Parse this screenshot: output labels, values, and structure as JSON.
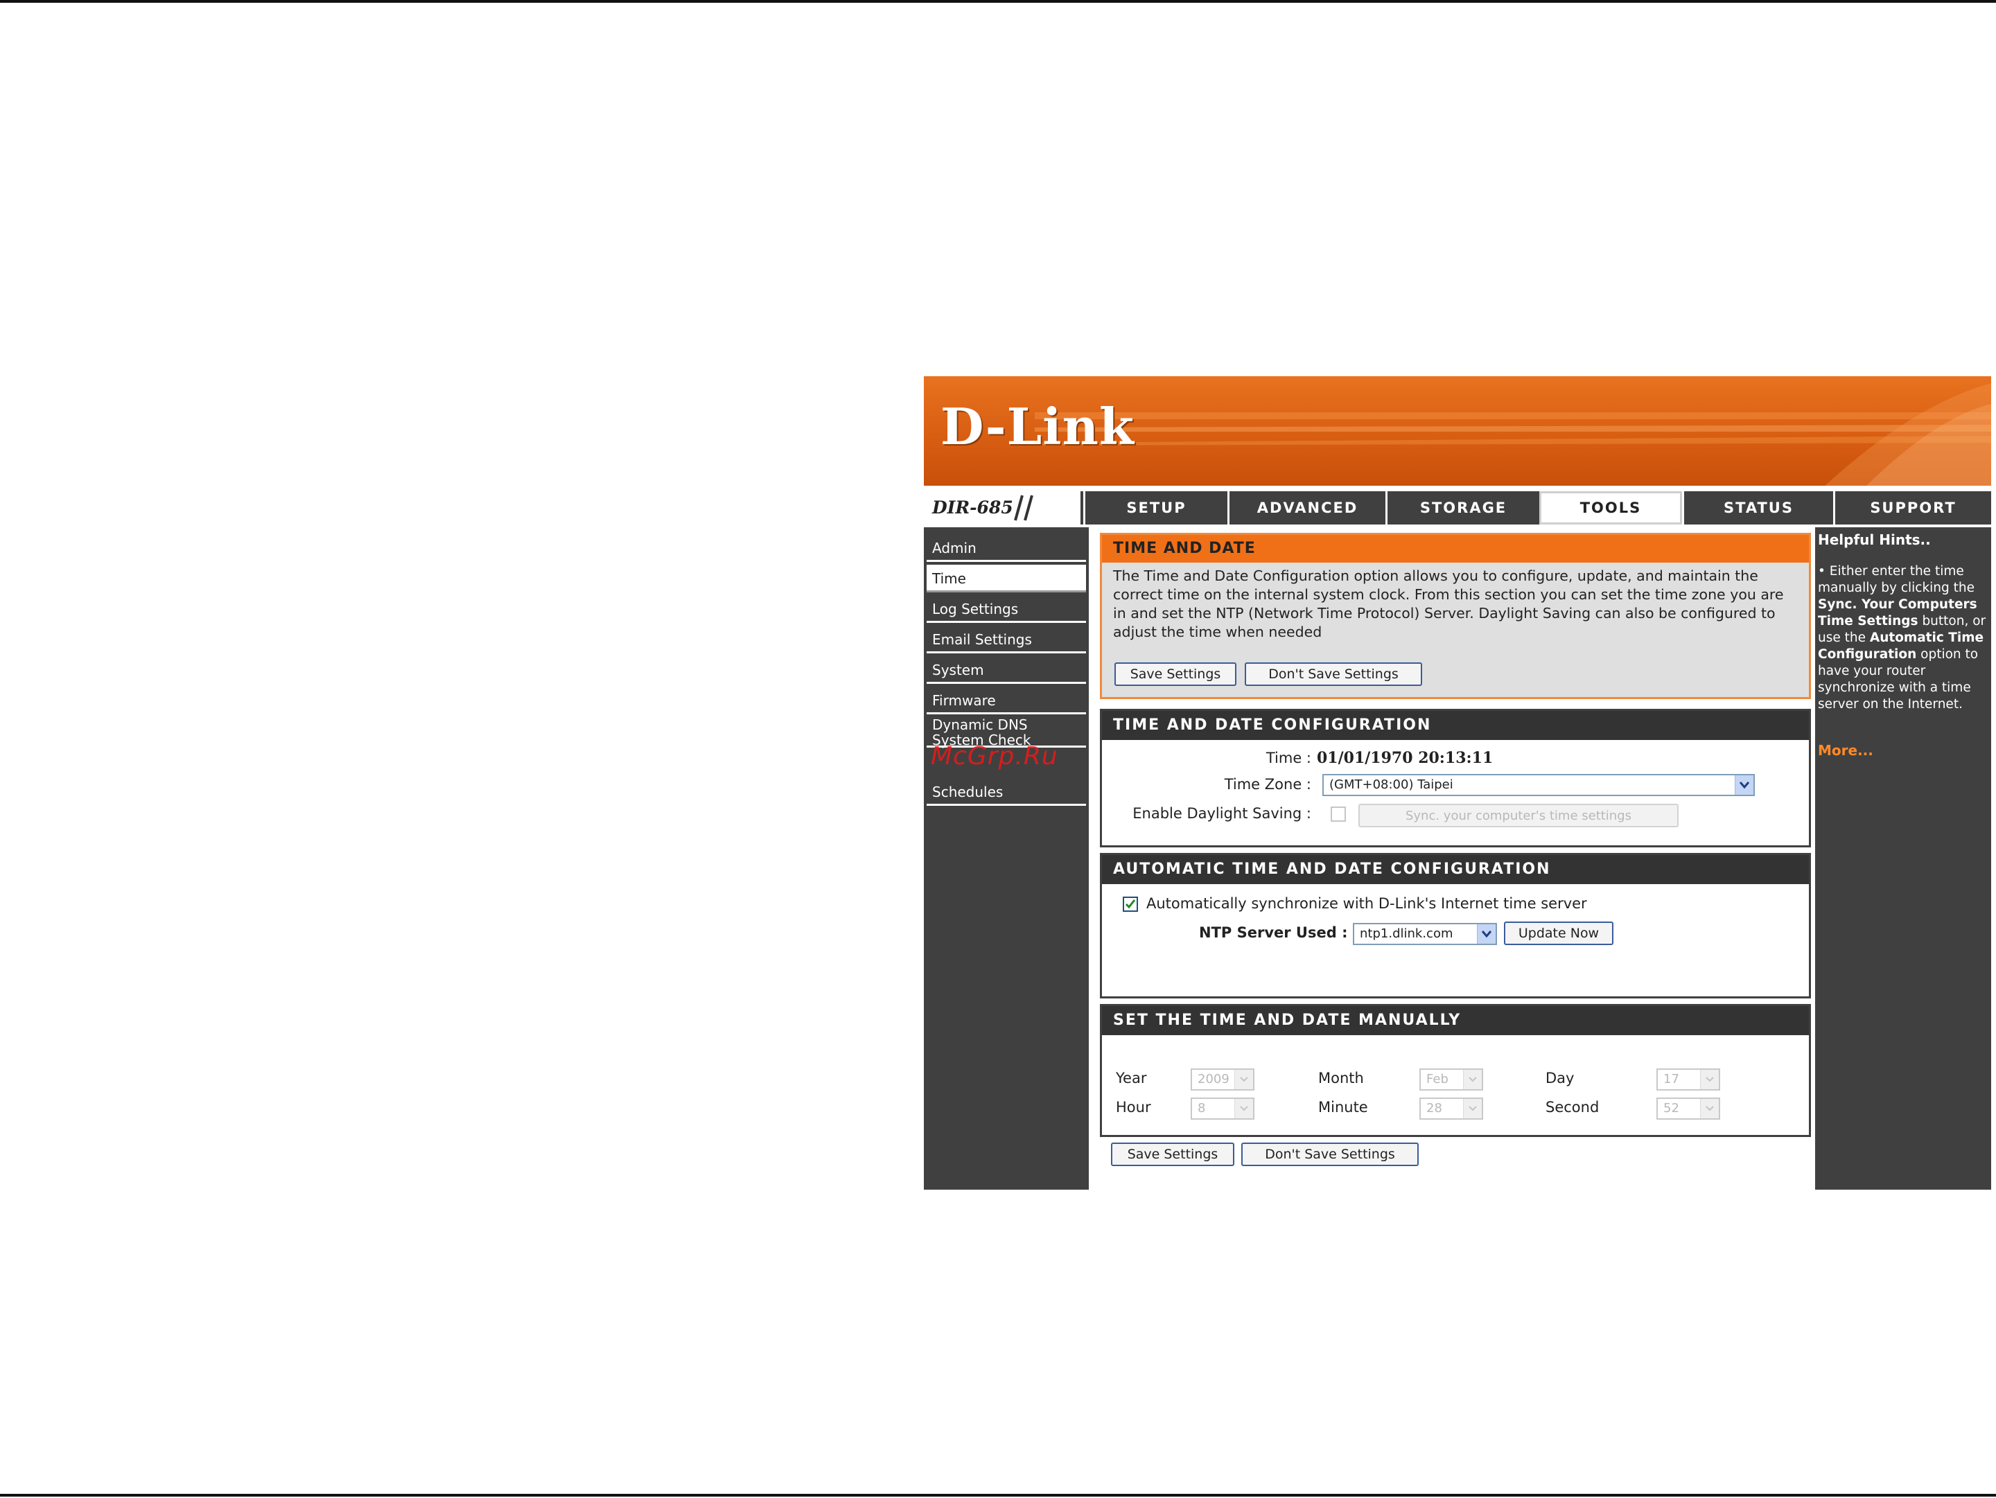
{
  "brand": {
    "logo": "D-Link",
    "model": "DIR-685"
  },
  "nav": {
    "tabs": [
      {
        "label": "SETUP"
      },
      {
        "label": "ADVANCED"
      },
      {
        "label": "STORAGE"
      },
      {
        "label": "TOOLS",
        "active": true
      },
      {
        "label": "STATUS"
      },
      {
        "label": "SUPPORT"
      }
    ]
  },
  "sidebar": {
    "items": [
      {
        "label": "Admin"
      },
      {
        "label": "Time",
        "active": true
      },
      {
        "label": "Log Settings"
      },
      {
        "label": "Email Settings"
      },
      {
        "label": "System"
      },
      {
        "label": "Firmware"
      },
      {
        "label": "Dynamic DNS"
      },
      {
        "label": "System Check"
      },
      {
        "label": "Schedules"
      }
    ]
  },
  "watermark": "McGrp.Ru",
  "intro": {
    "title": "TIME AND DATE",
    "text": "The Time and Date Configuration option allows you to configure, update, and maintain the correct time on the internal system clock. From this section you can set the time zone you are in and set the NTP (Network Time Protocol) Server. Daylight Saving can also be configured to adjust the time when needed",
    "save_label": "Save Settings",
    "dont_save_label": "Don't Save Settings"
  },
  "config": {
    "title": "TIME AND DATE CONFIGURATION",
    "time_label": "Time :",
    "time_value": "01/01/1970 20:13:11",
    "timezone_label": "Time Zone :",
    "timezone_value": "(GMT+08:00) Taipei",
    "daylight_label": "Enable Daylight Saving :",
    "daylight_checked": false,
    "sync_button_label": "Sync. your computer's time settings"
  },
  "auto": {
    "title": "AUTOMATIC TIME AND DATE CONFIGURATION",
    "auto_sync_label": "Automatically synchronize with D-Link's Internet time server",
    "auto_sync_checked": true,
    "ntp_label": "NTP Server Used :",
    "ntp_value": "ntp1.dlink.com",
    "update_label": "Update Now"
  },
  "manual": {
    "title": "SET THE TIME AND DATE MANUALLY",
    "year_label": "Year",
    "year_value": "2009",
    "month_label": "Month",
    "month_value": "Feb",
    "day_label": "Day",
    "day_value": "17",
    "hour_label": "Hour",
    "hour_value": "8",
    "minute_label": "Minute",
    "minute_value": "28",
    "second_label": "Second",
    "second_value": "52"
  },
  "footer": {
    "save_label": "Save Settings",
    "dont_save_label": "Don't Save Settings"
  },
  "hints": {
    "title": "Helpful Hints..",
    "p1": "• Either enter the time manually by clicking the ",
    "b1": "Sync. Your Computers Time Settings",
    "p2": " button, or use the ",
    "b2": "Automatic Time Configuration",
    "p3": " option to have your router synchronize with a time server on the Internet.",
    "more": "More..."
  },
  "colors": {
    "accent": "#e86a1a",
    "panel": "#404040",
    "header": "#333333"
  }
}
